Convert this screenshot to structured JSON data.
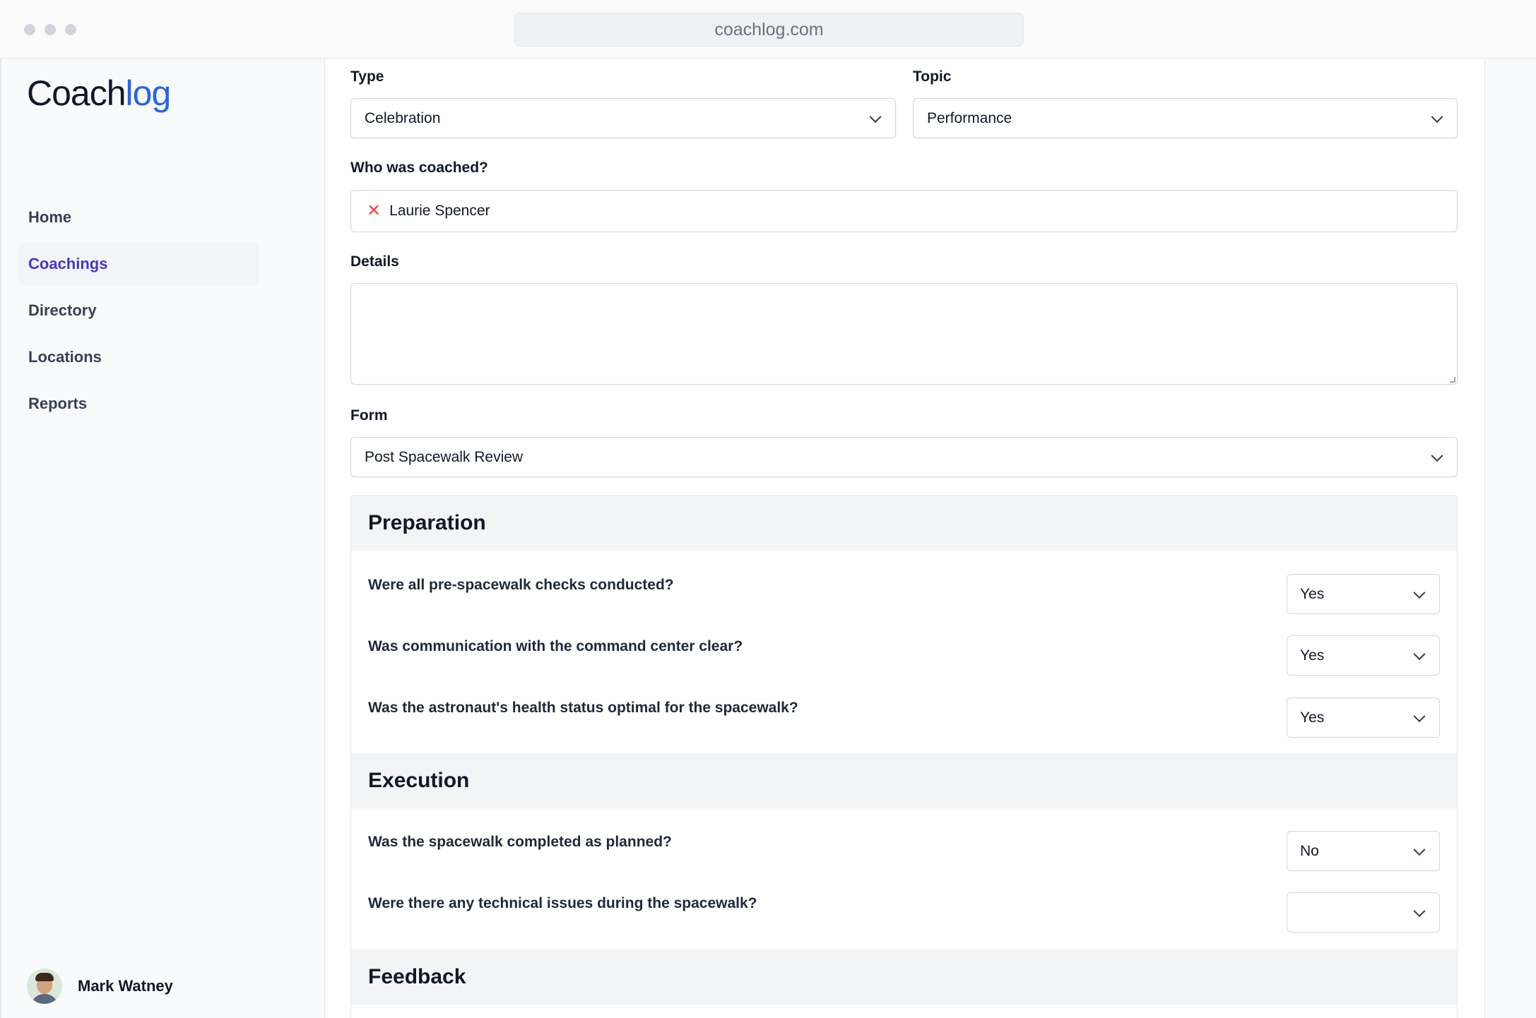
{
  "browser": {
    "url": "coachlog.com"
  },
  "sidebar": {
    "logo": {
      "part1": "Coach",
      "part2": "log"
    },
    "items": [
      {
        "label": "Home",
        "active": false
      },
      {
        "label": "Coachings",
        "active": true
      },
      {
        "label": "Directory",
        "active": false
      },
      {
        "label": "Locations",
        "active": false
      },
      {
        "label": "Reports",
        "active": false
      }
    ],
    "user": {
      "name": "Mark Watney"
    }
  },
  "main": {
    "type": {
      "label": "Type",
      "value": "Celebration"
    },
    "topic": {
      "label": "Topic",
      "value": "Performance"
    },
    "who": {
      "label": "Who was coached?",
      "value": "Laurie Spencer"
    },
    "details": {
      "label": "Details",
      "value": ""
    },
    "form": {
      "label": "Form",
      "value": "Post Spacewalk Review"
    },
    "sections": [
      {
        "title": "Preparation",
        "questions": [
          {
            "text": "Were all pre-spacewalk checks conducted?",
            "answer": "Yes"
          },
          {
            "text": "Was communication with the command center clear?",
            "answer": "Yes"
          },
          {
            "text": "Was the astronaut's health status optimal for the spacewalk?",
            "answer": "Yes"
          }
        ]
      },
      {
        "title": "Execution",
        "questions": [
          {
            "text": "Was the spacewalk completed as planned?",
            "answer": "No"
          },
          {
            "text": "Were there any technical issues during the spacewalk?",
            "answer": ""
          }
        ]
      },
      {
        "title": "Feedback",
        "questions": []
      }
    ]
  }
}
